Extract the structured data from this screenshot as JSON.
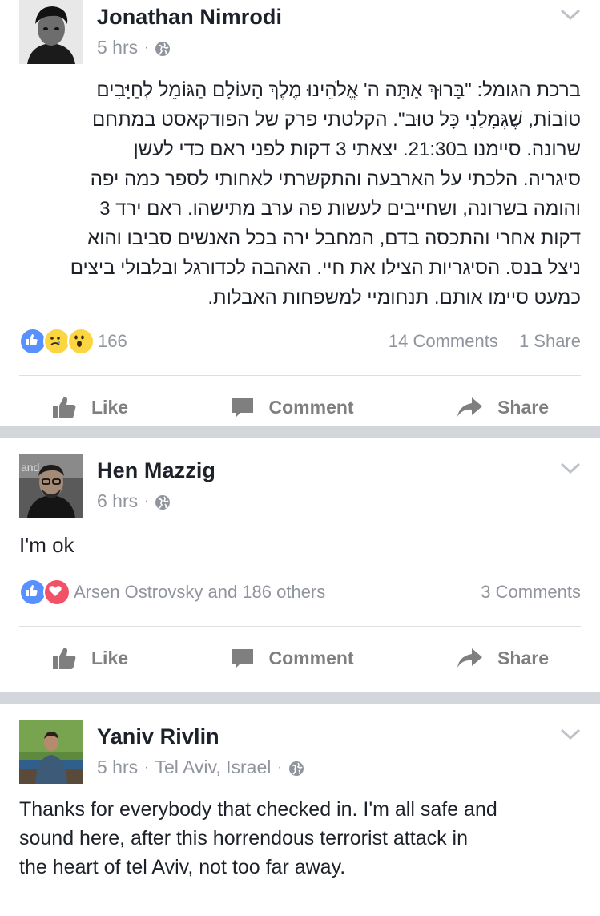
{
  "posts": [
    {
      "author": "Jonathan Nimrodi",
      "time": "5 hrs",
      "location": "",
      "text_lines": [
        "ברכת הגומל: \"בָּרוּךְ אַתָּה ה' אֱלֹהֵינוּ מֶלֶךְ הָעוֹלָם הַגּוֹמֵל לְחַיָּבִים",
        "טוֹבוֹת, שֶׁגְּמָלַנִי כָּל טוּב\". הקלטתי פרק של הפודקאסט במתחם",
        "שרונה. סיימנו ב21:30. יצאתי 3 דקות לפני ראם כדי לעשן",
        "סיגריה. הלכתי על הארבעה והתקשרתי לאחותי לספר כמה יפה",
        "והומה בשרונה, ושחייבים לעשות פה ערב מתישהו. ראם ירד 3",
        "דקות אחרי והתכסה בדם, המחבל ירה בכל האנשים סביבו והוא",
        "ניצל בנס. הסיגריות הצילו את חיי. האהבה לכדורגל ובלבולי ביצים",
        "כמעט סיימו אותם. תנחומיי למשפחות האבלות."
      ],
      "reaction_count": "166",
      "comments": "14 Comments",
      "shares": "1 Share",
      "reaction_icons": [
        "like-icon",
        "sad-icon",
        "wow-icon"
      ]
    },
    {
      "author": "Hen Mazzig",
      "time": "6 hrs",
      "location": "",
      "text_lines": [
        "I'm ok"
      ],
      "reaction_count": "Arsen Ostrovsky and 186 others",
      "comments": "3 Comments",
      "shares": "",
      "reaction_icons": [
        "like-icon",
        "love-icon"
      ]
    },
    {
      "author": "Yaniv Rivlin",
      "time": "5 hrs",
      "location": "Tel Aviv, Israel",
      "text_lines": [
        "Thanks for everybody that checked in. I'm all safe and",
        "sound here, after this horrendous terrorist attack in",
        "the heart of tel Aviv, not too far away."
      ]
    }
  ],
  "actions": {
    "like": "Like",
    "comment": "Comment",
    "share": "Share"
  },
  "meta_separator": "·",
  "colors": {
    "like_blue": "#5890ff",
    "love_red": "#f25268",
    "emoji_yellow": "#fcd640",
    "meta_gray": "#90949c",
    "action_gray": "#7f7f7f"
  }
}
